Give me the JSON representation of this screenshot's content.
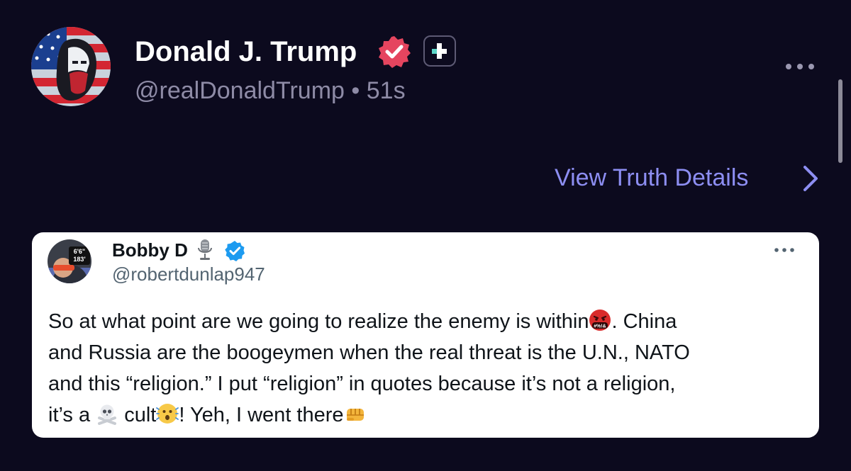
{
  "post": {
    "author_name": "Donald J. Trump",
    "handle": "@realDonaldTrump",
    "separator": "•",
    "time_ago": "51s",
    "view_details_label": "View Truth Details"
  },
  "quoted": {
    "author_name": "Bobby D",
    "handle": "@robertdunlap947",
    "body": {
      "line1_before": "So at what point are we going to realize the enemy is within",
      "line1_after": ". China",
      "line2": "and Russia are the boogeymen when the real threat is the U.N., NATO",
      "line3": "and this “religion.” I put “religion” in quotes because it’s not a religion,",
      "line4_a": "it’s a ",
      "line4_b": " cult",
      "line4_c": "! Yeh, I went there"
    },
    "avatar_text": {
      "top": "6'6\"",
      "bottom": "183'"
    },
    "emoji_cursing_text": "#%!&"
  },
  "icons": {
    "verified_main": "verified-badge-icon",
    "plus_badge": "plus-badge-icon",
    "more": "more-options-icon",
    "chevron": "chevron-right-icon",
    "mic": "microphone-icon",
    "verified_quoted": "verified-check-icon",
    "emoji_cursing": "angry-cursing-face-emoji",
    "emoji_skull": "skull-crossbones-emoji",
    "emoji_shocked": "shocked-face-emoji",
    "emoji_fist": "oncoming-fist-emoji"
  },
  "colors": {
    "background": "#0c0a1e",
    "link": "#8d8ef2",
    "verified_main": "#e5455f",
    "plus_badge_accent": "#5cd6c8",
    "verified_quoted": "#1d9bf0",
    "muted_text": "#8e8ba6"
  }
}
